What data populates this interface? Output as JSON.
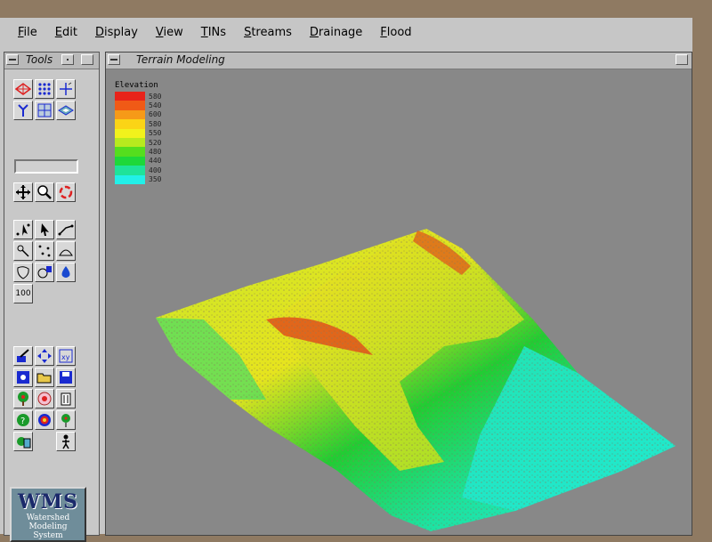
{
  "menubar": {
    "items": [
      {
        "u": "F",
        "rest": "ile"
      },
      {
        "u": "E",
        "rest": "dit"
      },
      {
        "u": "D",
        "rest": "isplay"
      },
      {
        "u": "V",
        "rest": "iew"
      },
      {
        "u": "T",
        "rest": "INs"
      },
      {
        "u": "S",
        "rest": "treams"
      },
      {
        "u": "D",
        "rest": "rainage"
      },
      {
        "u": "F",
        "rest": "lood"
      }
    ]
  },
  "tools_panel": {
    "title": "Tools",
    "icons": [
      "tin-icon",
      "points-grid-icon",
      "axes-icon",
      "stream-network-icon",
      "grid-icon",
      "layers-icon",
      "pan-icon",
      "zoom-icon",
      "rotate-icon",
      "select-vertex-icon",
      "select-arrow-icon",
      "create-line-icon",
      "drainage-point-icon",
      "scatter-icon",
      "contour-icon",
      "basin-icon",
      "calculator-icon",
      "water-drop-icon",
      "map-100-icon",
      "edit-icon",
      "move-icon",
      "xyz-icon",
      "frame-icon",
      "open-folder-icon",
      "save-icon",
      "tree-icon",
      "flower-icon",
      "delete-icon",
      "help-icon",
      "target-icon",
      "basin-tree-icon",
      "calculator-2-icon",
      "person-icon"
    ],
    "scale_label": "100",
    "logo": {
      "title": "WMS",
      "line1": "Watershed",
      "line2": "Modeling",
      "line3": "System"
    }
  },
  "terrain_window": {
    "title": "Terrain Modeling",
    "legend": {
      "title": "Elevation",
      "entries": [
        {
          "value": "580",
          "color": "#e8231a"
        },
        {
          "value": "540",
          "color": "#f05a16"
        },
        {
          "value": "600",
          "color": "#f69a18"
        },
        {
          "value": "580",
          "color": "#fbd416"
        },
        {
          "value": "550",
          "color": "#f2f21c"
        },
        {
          "value": "520",
          "color": "#b8ea1e"
        },
        {
          "value": "480",
          "color": "#55de1e"
        },
        {
          "value": "440",
          "color": "#1ed83a"
        },
        {
          "value": "400",
          "color": "#1fe39a"
        },
        {
          "value": "350",
          "color": "#22f0e8"
        }
      ]
    }
  }
}
